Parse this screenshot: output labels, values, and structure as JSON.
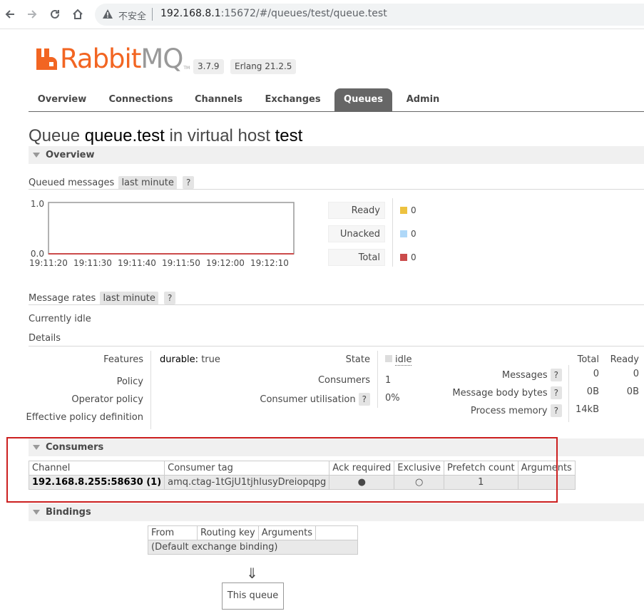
{
  "browser": {
    "back": "←",
    "forward": "→",
    "reload": "↻",
    "home": "⌂",
    "security": "不安全",
    "url_host": "192.168.8.1",
    "url_rest": ":15672/#/queues/test/queue.test"
  },
  "header": {
    "brand_main": "Rabbit",
    "brand_mq": "MQ",
    "tm": "TM",
    "version": "3.7.9",
    "erlang": "Erlang 21.2.5",
    "accent": "#f26522"
  },
  "tabs": [
    {
      "label": "Overview"
    },
    {
      "label": "Connections"
    },
    {
      "label": "Channels"
    },
    {
      "label": "Exchanges"
    },
    {
      "label": "Queues"
    },
    {
      "label": "Admin"
    }
  ],
  "title": {
    "prefix": "Queue",
    "queue": "queue.test",
    "mid": "in virtual host",
    "vhost": "test"
  },
  "overview": {
    "section_label": "Overview",
    "queued_label": "Queued messages",
    "range": "last minute",
    "help": "?",
    "y_top": "1.0",
    "y_bottom": "0.0",
    "x_ticks": [
      "19:11:20",
      "19:11:30",
      "19:11:40",
      "19:11:50",
      "19:12:00",
      "19:12:10"
    ],
    "legend": [
      {
        "label": "Ready",
        "value": "0",
        "color": "#edc240"
      },
      {
        "label": "Unacked",
        "value": "0",
        "color": "#afd8f8"
      },
      {
        "label": "Total",
        "value": "0",
        "color": "#cb4b4b"
      }
    ],
    "rates_label": "Message rates",
    "rates_range": "last minute",
    "idle_text": "Currently idle",
    "details_label": "Details"
  },
  "details": {
    "features_label": "Features",
    "features_key": "durable:",
    "features_val": "true",
    "policy_label": "Policy",
    "operator_policy_label": "Operator policy",
    "effective_label": "Effective policy definition",
    "state_label": "State",
    "state_val": "idle",
    "consumers_label": "Consumers",
    "consumers_val": "1",
    "util_label": "Consumer utilisation",
    "util_val": "0%",
    "col_total": "Total",
    "col_ready": "Ready",
    "messages_label": "Messages",
    "messages_total": "0",
    "messages_ready": "0",
    "body_label": "Message body bytes",
    "body_total": "0B",
    "body_ready": "0B",
    "memory_label": "Process memory",
    "memory_total": "14kB"
  },
  "consumers": {
    "section_label": "Consumers",
    "headers": [
      "Channel",
      "Consumer tag",
      "Ack required",
      "Exclusive",
      "Prefetch count",
      "Arguments"
    ],
    "row": {
      "channel": "192.168.8.255:58630 (1)",
      "tag": "amq.ctag-1tGjU1tjhIusyDreiopqpg",
      "ack": "●",
      "exclusive": "○",
      "prefetch": "1",
      "arguments": ""
    }
  },
  "bindings": {
    "section_label": "Bindings",
    "headers": [
      "From",
      "Routing key",
      "Arguments"
    ],
    "default_row": "(Default exchange binding)",
    "arrow": "⇓",
    "this_queue": "This queue"
  }
}
